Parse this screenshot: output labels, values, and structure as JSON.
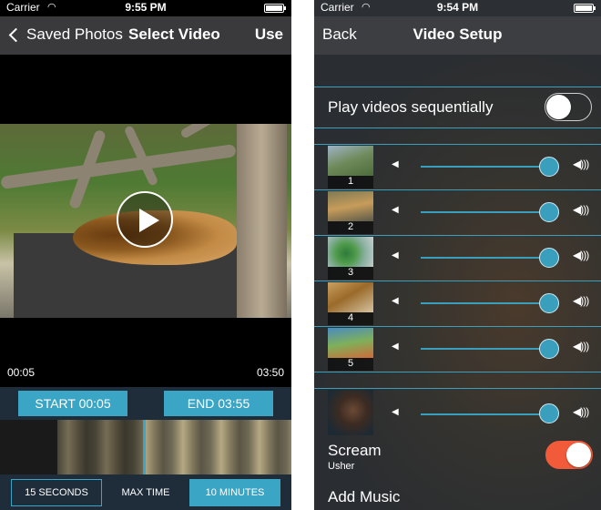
{
  "left": {
    "status": {
      "carrier": "Carrier",
      "time": "9:55 PM"
    },
    "nav": {
      "back_label": "Saved Photos",
      "title": "Select Video",
      "action_label": "Use"
    },
    "video": {
      "elapsed": "00:05",
      "duration": "03:50"
    },
    "trim": {
      "start_label": "START 00:05",
      "end_label": "END 03:55"
    },
    "durations": [
      {
        "label": "15 SECONDS",
        "state": "outlined"
      },
      {
        "label": "MAX TIME",
        "state": "plain"
      },
      {
        "label": "10 MINUTES",
        "state": "selected"
      }
    ]
  },
  "right": {
    "status": {
      "carrier": "Carrier",
      "time": "9:54 PM"
    },
    "nav": {
      "back_label": "Back",
      "title": "Video Setup"
    },
    "sequential": {
      "label": "Play videos sequentially",
      "on": false
    },
    "videos": [
      {
        "number": "1",
        "volume": 1.0
      },
      {
        "number": "2",
        "volume": 1.0
      },
      {
        "number": "3",
        "volume": 1.0
      },
      {
        "number": "4",
        "volume": 1.0
      },
      {
        "number": "5",
        "volume": 1.0
      }
    ],
    "music": {
      "title": "Scream",
      "artist": "Usher",
      "volume": 1.0,
      "enabled": true
    },
    "add_music_label": "Add Music"
  },
  "colors": {
    "accent": "#3aa5c4",
    "toggle_on": "#f25b3a"
  }
}
